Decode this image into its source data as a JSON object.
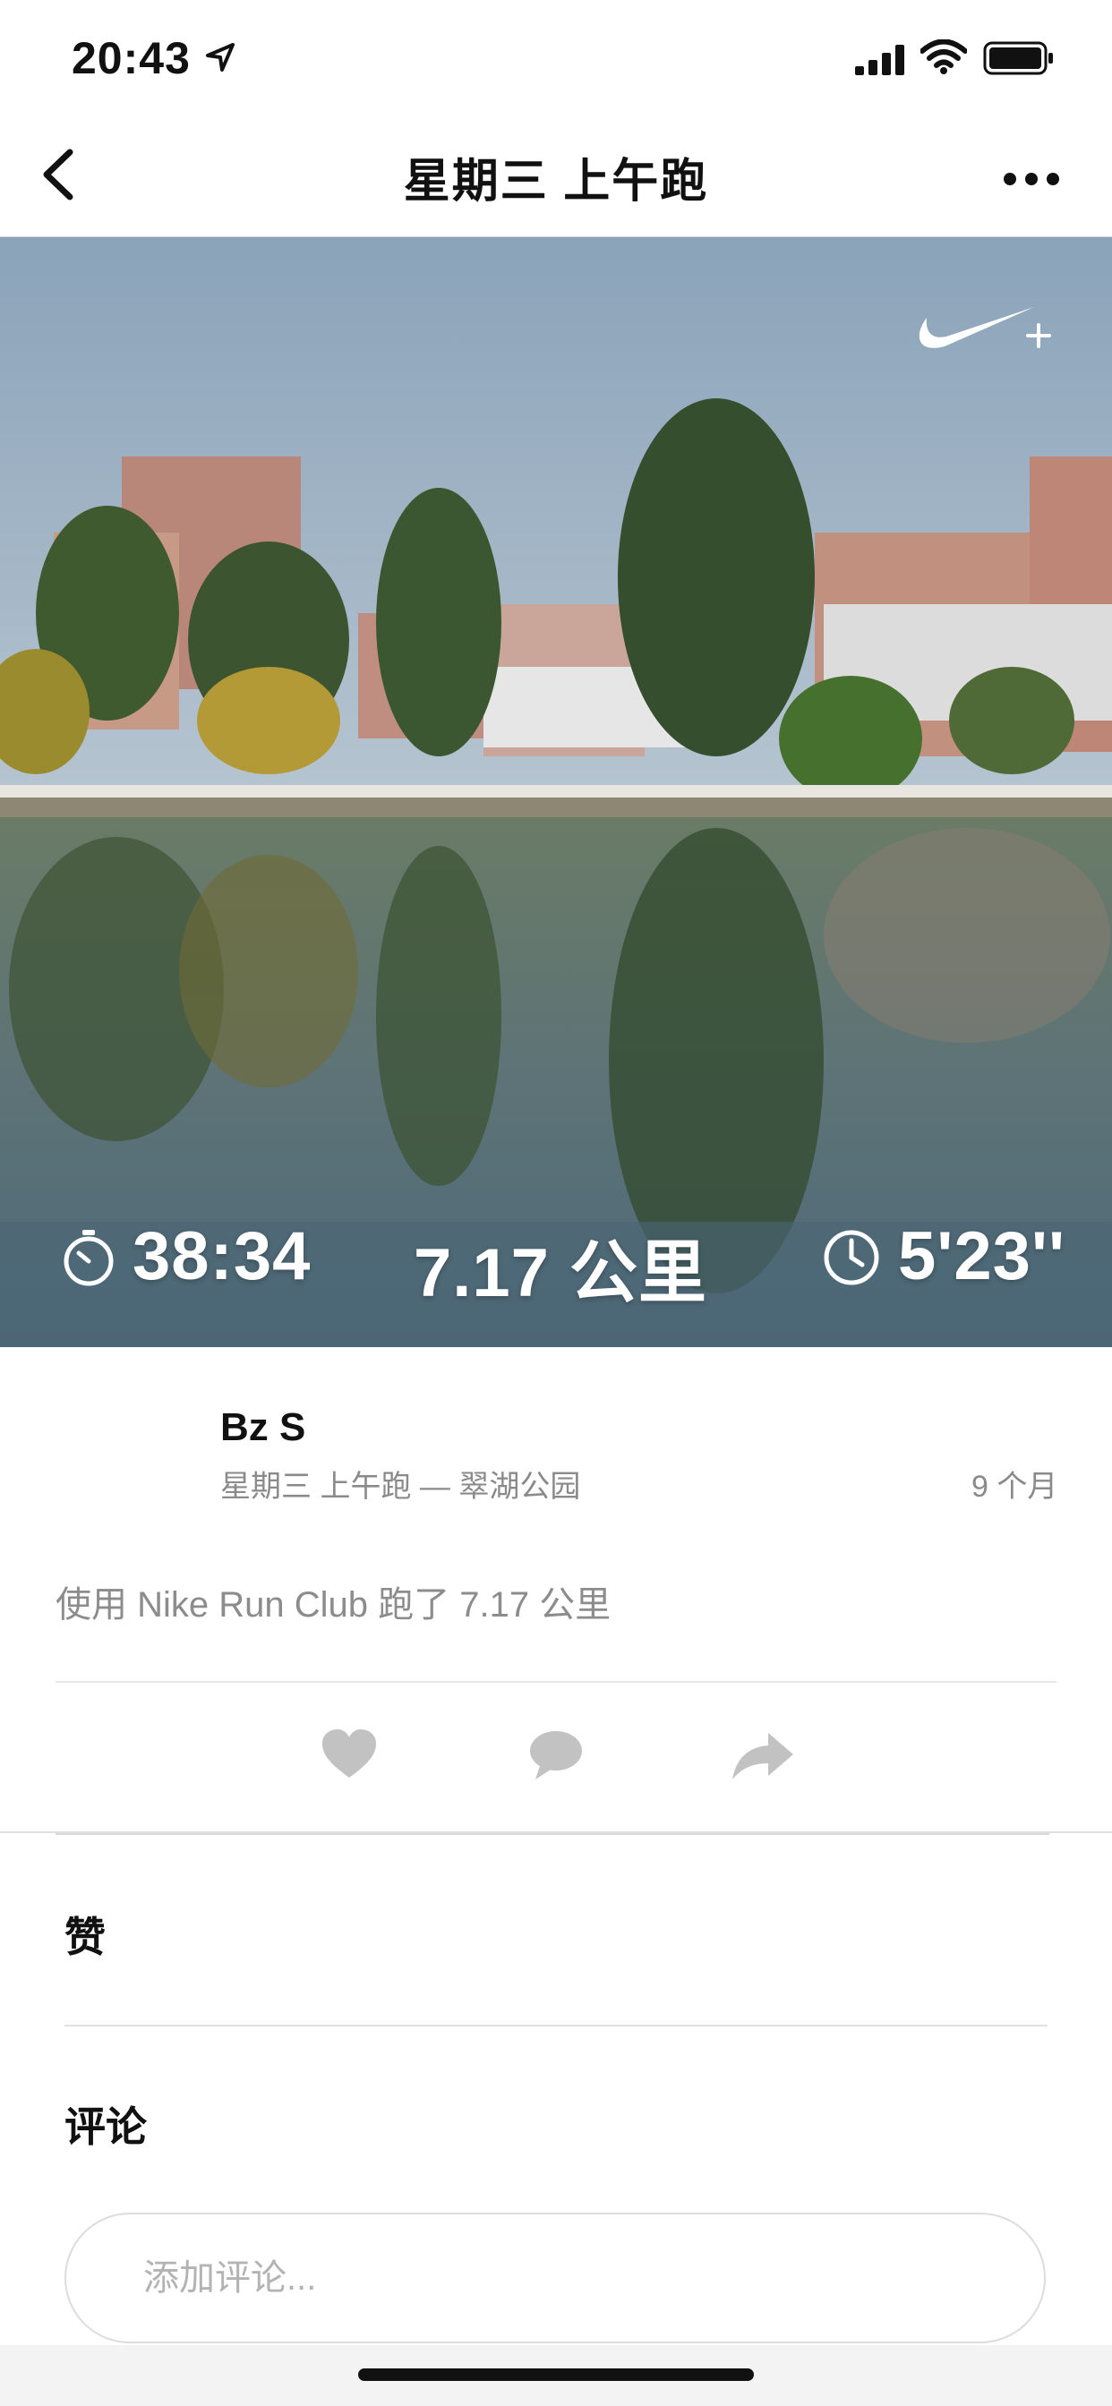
{
  "status_bar": {
    "time": "20:43",
    "icons": [
      "location-arrow-icon",
      "signal-icon",
      "wifi-icon",
      "battery-icon"
    ]
  },
  "nav": {
    "title": "星期三  上午跑",
    "back_icon": "chevron-left-icon",
    "more_icon": "more-dots-icon"
  },
  "hero": {
    "brand_icon": "nike-run-club-swoosh-icon",
    "stats": {
      "duration": "38:34",
      "distance": "7.17 公里",
      "pace": "5'23''"
    }
  },
  "post": {
    "user_name": "Bz S",
    "meta": "星期三  上午跑 — 翠湖公园",
    "age": "9 个月",
    "description": "使用 Nike Run Club 跑了 7.17 公里"
  },
  "actions": {
    "like_icon": "heart-icon",
    "comment_icon": "speech-bubble-icon",
    "share_icon": "share-arrow-icon"
  },
  "likes_section": {
    "heading": "赞"
  },
  "comments_section": {
    "heading": "评论",
    "input_placeholder": "添加评论..."
  },
  "colors": {
    "text_primary": "#111111",
    "text_secondary": "#8a8a8a",
    "icon_gray": "#c2c2c2",
    "divider": "#e0e0e0"
  }
}
